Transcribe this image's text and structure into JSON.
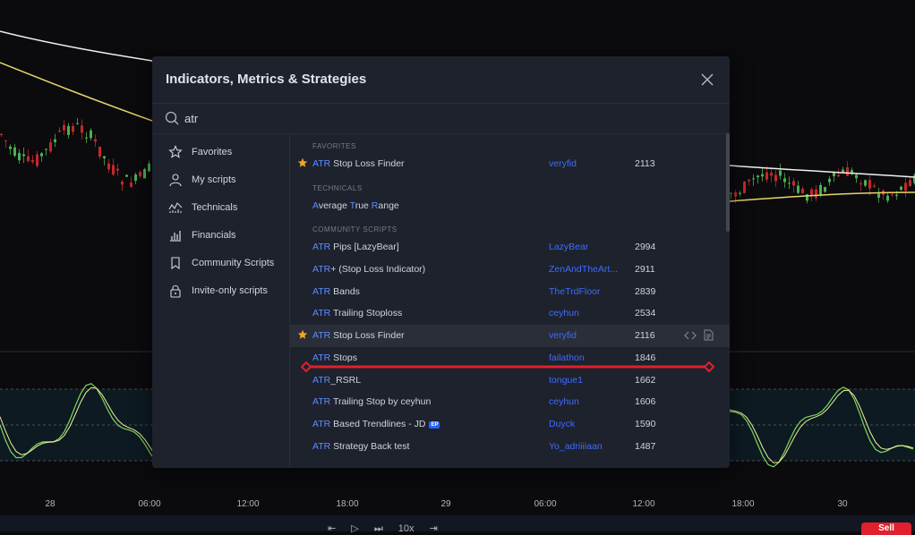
{
  "chart": {
    "time_labels": [
      "28",
      "06:00",
      "12:00",
      "18:00",
      "29",
      "06:00",
      "12:00",
      "18:00",
      "30"
    ],
    "sell_label": "Sell",
    "replay_speed": "10x"
  },
  "dialog": {
    "title": "Indicators, Metrics & Strategies",
    "search": {
      "value": "atr"
    }
  },
  "sidebar": {
    "items": [
      {
        "label": "Favorites",
        "icon": "star-icon"
      },
      {
        "label": "My scripts",
        "icon": "user-icon"
      },
      {
        "label": "Technicals",
        "icon": "technicals-icon"
      },
      {
        "label": "Financials",
        "icon": "financials-icon"
      },
      {
        "label": "Community Scripts",
        "icon": "bookmark-icon"
      },
      {
        "label": "Invite-only scripts",
        "icon": "lock-icon"
      }
    ]
  },
  "results": {
    "favorites_title": "FAVORITES",
    "technicals_title": "TECHNICALS",
    "community_title": "COMMUNITY SCRIPTS",
    "favorites": [
      {
        "hl": "ATR",
        "rest": " Stop Loss Finder",
        "author": "veryfid",
        "count": "2113",
        "starred": true
      }
    ],
    "technicals": {
      "parts": [
        "A",
        "verage ",
        "T",
        "rue ",
        "R",
        "ange"
      ]
    },
    "community": [
      {
        "hl": "ATR",
        "rest": " Pips [LazyBear]",
        "author": "LazyBear",
        "count": "2994"
      },
      {
        "hl": "ATR",
        "rest": "+ (Stop Loss Indicator)",
        "author": "ZenAndTheArt...",
        "count": "2911"
      },
      {
        "hl": "ATR",
        "rest": " Bands",
        "author": "TheTrdFloor",
        "count": "2839"
      },
      {
        "hl": "ATR",
        "rest": " Trailing Stoploss",
        "author": "ceyhun",
        "count": "2534"
      },
      {
        "hl": "ATR",
        "rest": " Stop Loss Finder",
        "author": "veryfid",
        "count": "2116",
        "starred": true,
        "hover": true
      },
      {
        "hl": "ATR",
        "rest": " Stops",
        "author": "failathon",
        "count": "1846"
      },
      {
        "hl": "ATR",
        "rest": "_RSRL",
        "author": "tongue1",
        "count": "1662"
      },
      {
        "hl": "ATR",
        "rest": " Trailing Stop by ceyhun",
        "author": "ceyhun",
        "count": "1606"
      },
      {
        "hl": "ATR",
        "rest": " Based Trendlines - JD",
        "author": "Duyck",
        "count": "1590",
        "badge": "EP"
      },
      {
        "hl": "ATR",
        "rest": " Strategy Back test",
        "author": "Yo_adriiiiaan",
        "count": "1487"
      }
    ]
  },
  "colors": {
    "accent": "#2962ff",
    "star": "#f5a623",
    "annotation": "#e0202f"
  }
}
